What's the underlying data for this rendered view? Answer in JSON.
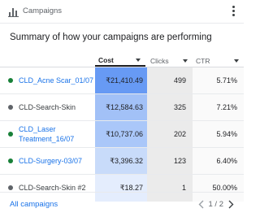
{
  "header": {
    "title": "Campaigns",
    "icon": "bar-chart-icon",
    "menu_icon": "more-vert-icon"
  },
  "summary_title": "Summary of how your campaigns are performing",
  "table": {
    "headers": {
      "cost": "Cost",
      "clicks": "Clicks",
      "ctr": "CTR"
    },
    "rows": [
      {
        "name_lines": [
          "CLD_Acne Scar_01/07"
        ],
        "status": "active",
        "status_color": "#188038",
        "link": true,
        "cost": "₹21,410.49",
        "clicks": "499",
        "ctr": "5.71%",
        "heat_color": "#679af4"
      },
      {
        "name_lines": [
          "CLD-Search-Skin"
        ],
        "status": "paused",
        "status_color": "#5f6368",
        "link": false,
        "cost": "₹12,584.63",
        "clicks": "325",
        "ctr": "7.21%",
        "heat_color": "#a2c1f7"
      },
      {
        "name_lines": [
          "CLD_Laser",
          "Treatment_16/07"
        ],
        "status": "active",
        "status_color": "#188038",
        "link": true,
        "cost": "₹10,737.06",
        "clicks": "202",
        "ctr": "5.94%",
        "heat_color": "#aac7f9"
      },
      {
        "name_lines": [
          "CLD-Surgery-03/07"
        ],
        "status": "active",
        "status_color": "#188038",
        "link": true,
        "cost": "₹3,396.32",
        "clicks": "123",
        "ctr": "6.40%",
        "heat_color": "#c8dbfa"
      },
      {
        "name_lines": [
          "CLD-Search-Skin #2"
        ],
        "status": "paused",
        "status_color": "#5f6368",
        "link": false,
        "cost": "₹18.27",
        "clicks": "1",
        "ctr": "50.00%",
        "heat_color": "#e4edfd"
      }
    ]
  },
  "footer": {
    "all_campaigns_label": "All campaigns",
    "page_text": "1 / 2",
    "prev_icon": "chevron-left-icon",
    "next_icon": "chevron-right-icon"
  },
  "colors": {
    "link": "#1a73e8",
    "active_dot": "#188038",
    "paused_dot": "#5f6368"
  }
}
